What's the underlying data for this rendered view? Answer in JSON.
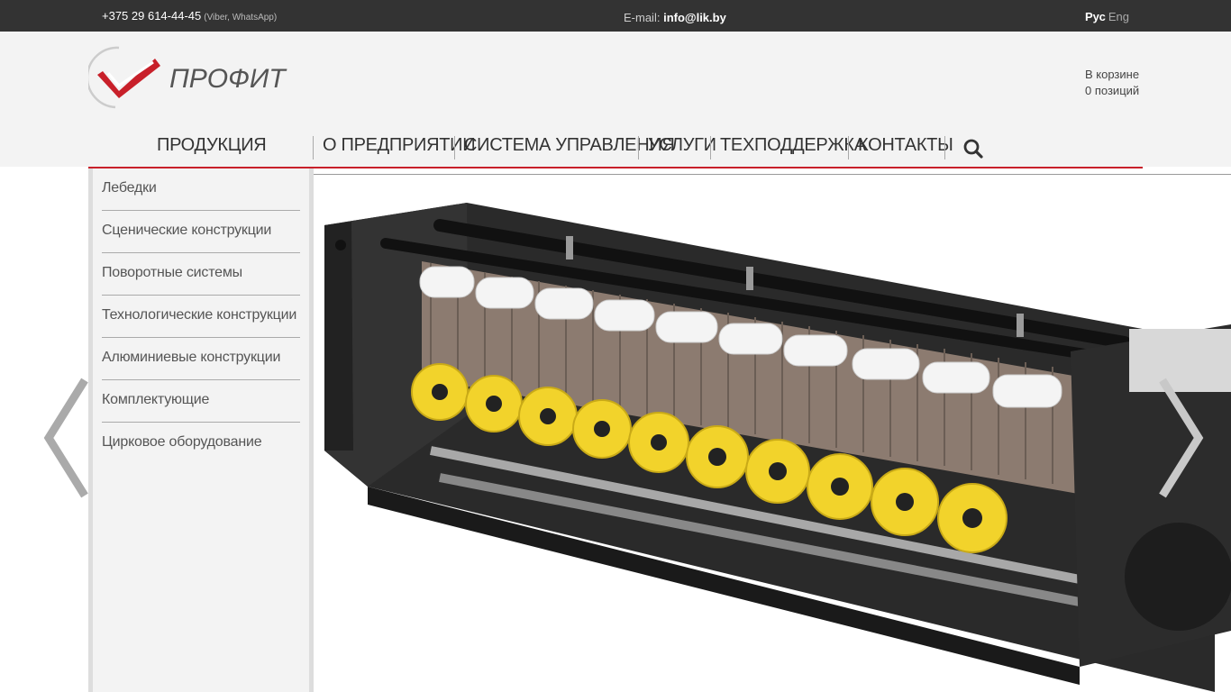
{
  "topbar": {
    "phone": "+375 29 614-44-45",
    "phone_note": "(Viber, WhatsApp)",
    "email_label": "E-mail:",
    "email": "info@lik.by",
    "lang_active": "Рус",
    "lang_other": "Eng"
  },
  "header": {
    "logo_text": "ПРОФИТ",
    "cart_title": "В корзине",
    "cart_count": "0 позиций"
  },
  "nav": {
    "items": [
      "ПРОДУКЦИЯ",
      "О ПРЕДПРИЯТИИ",
      "СИСТЕМА УПРАВЛЕНИЯ",
      "УСЛУГИ",
      "ТЕХПОДДЕРЖКА",
      "КОНТАКТЫ"
    ],
    "search_icon": "search-icon"
  },
  "dropdown": {
    "items": [
      "Лебедки",
      "Сценические конструкции",
      "Поворотные системы",
      "Технологические конструкции",
      "Алюминиевые конструкции",
      "Комплектующие",
      "Цирковое оборудование"
    ]
  },
  "slider": {
    "prev_icon": "chevron-left-icon",
    "next_icon": "chevron-right-icon"
  },
  "colors": {
    "accent": "#c8202a",
    "topbar": "#333333",
    "header": "#f3f3f3",
    "product_yellow": "#f2d32b"
  }
}
